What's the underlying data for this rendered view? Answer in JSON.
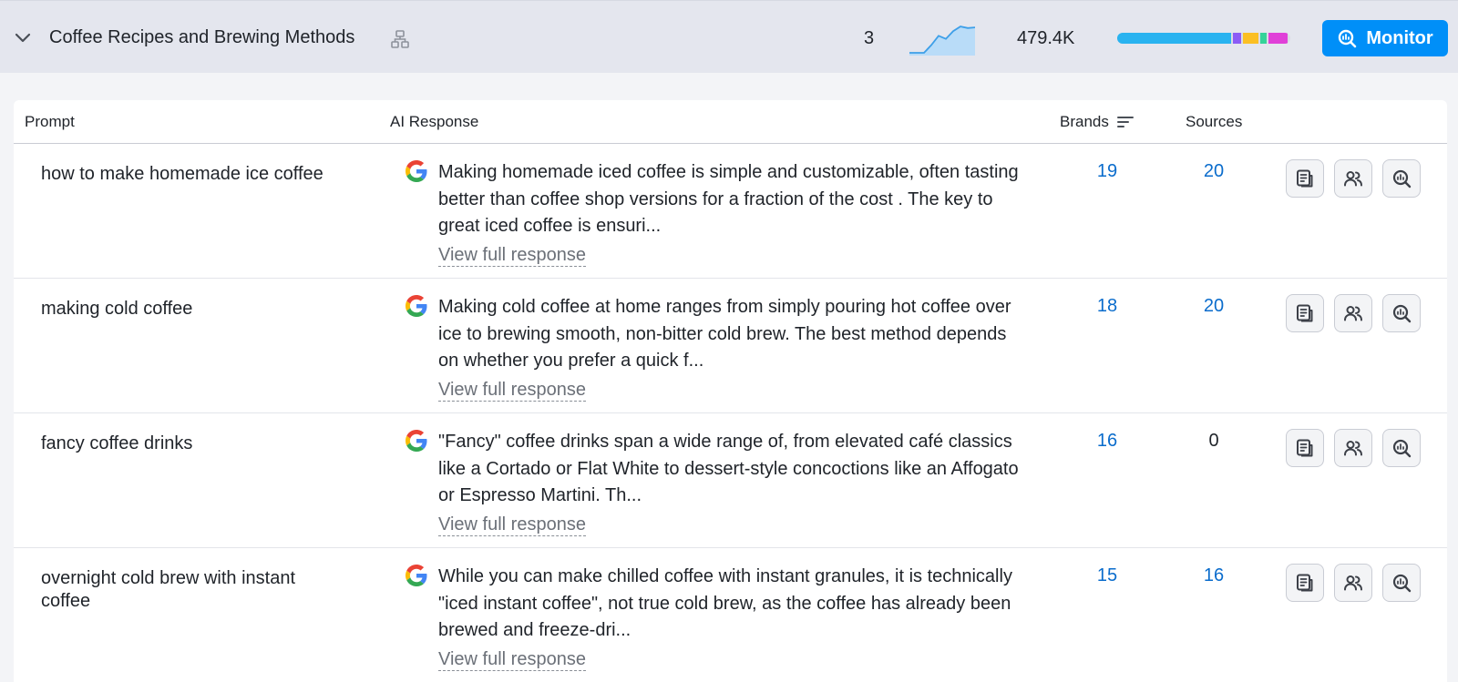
{
  "group": {
    "title": "Coffee Recipes and Brewing Methods",
    "prompt_count": "3",
    "volume": "479.4K",
    "monitor_label": "Monitor",
    "trend_values": [
      0,
      0,
      0,
      0.25,
      0.55,
      0.45,
      0.7,
      0.85,
      0.8,
      0.82
    ],
    "share_segments": [
      {
        "color": "#29b3f0",
        "fraction": 0.66
      },
      {
        "color": "#8b5cf6",
        "fraction": 0.045
      },
      {
        "color": "#fbbf24",
        "fraction": 0.09
      },
      {
        "color": "#34d399",
        "fraction": 0.035
      },
      {
        "color": "#e040d8",
        "fraction": 0.11
      }
    ]
  },
  "table": {
    "headers": {
      "prompt": "Prompt",
      "ai_response": "AI Response",
      "brands": "Brands",
      "sources": "Sources"
    },
    "view_full_label": "View full response",
    "rows": [
      {
        "prompt": "how to make homemade ice coffee",
        "response": "Making homemade iced coffee is simple and customizable, often tasting better than coffee shop versions for a fraction of the cost . The key to great iced coffee is ensuri...",
        "brands": "19",
        "sources": "20",
        "sources_link": true
      },
      {
        "prompt": "making cold coffee",
        "response": "Making cold coffee at home ranges from simply pouring hot coffee over ice to brewing smooth, non-bitter cold brew. The best method depends on whether you prefer a quick f...",
        "brands": "18",
        "sources": "20",
        "sources_link": true
      },
      {
        "prompt": "fancy coffee drinks",
        "response": "\"Fancy\" coffee drinks span a wide range of, from elevated café classics like a Cortado or Flat White to dessert-style concoctions like an Affogato or Espresso Martini. Th...",
        "brands": "16",
        "sources": "0",
        "sources_link": false
      },
      {
        "prompt": "overnight cold brew with instant coffee",
        "response": "While you can make chilled coffee with instant granules, it is technically \"iced instant coffee\", not true cold brew, as the coffee has already been brewed and freeze-dri...",
        "brands": "15",
        "sources": "16",
        "sources_link": true
      }
    ]
  },
  "colors": {
    "accent": "#008ff8",
    "link": "#0a6ccc",
    "header_bg": "#e4e6ee"
  },
  "icons": {
    "collapse": "chevron-down-icon",
    "hierarchy": "hierarchy-icon",
    "sort": "sort-icon",
    "engine": "google-icon",
    "actions": [
      "document-icon",
      "users-icon",
      "monitor-search-icon"
    ]
  }
}
